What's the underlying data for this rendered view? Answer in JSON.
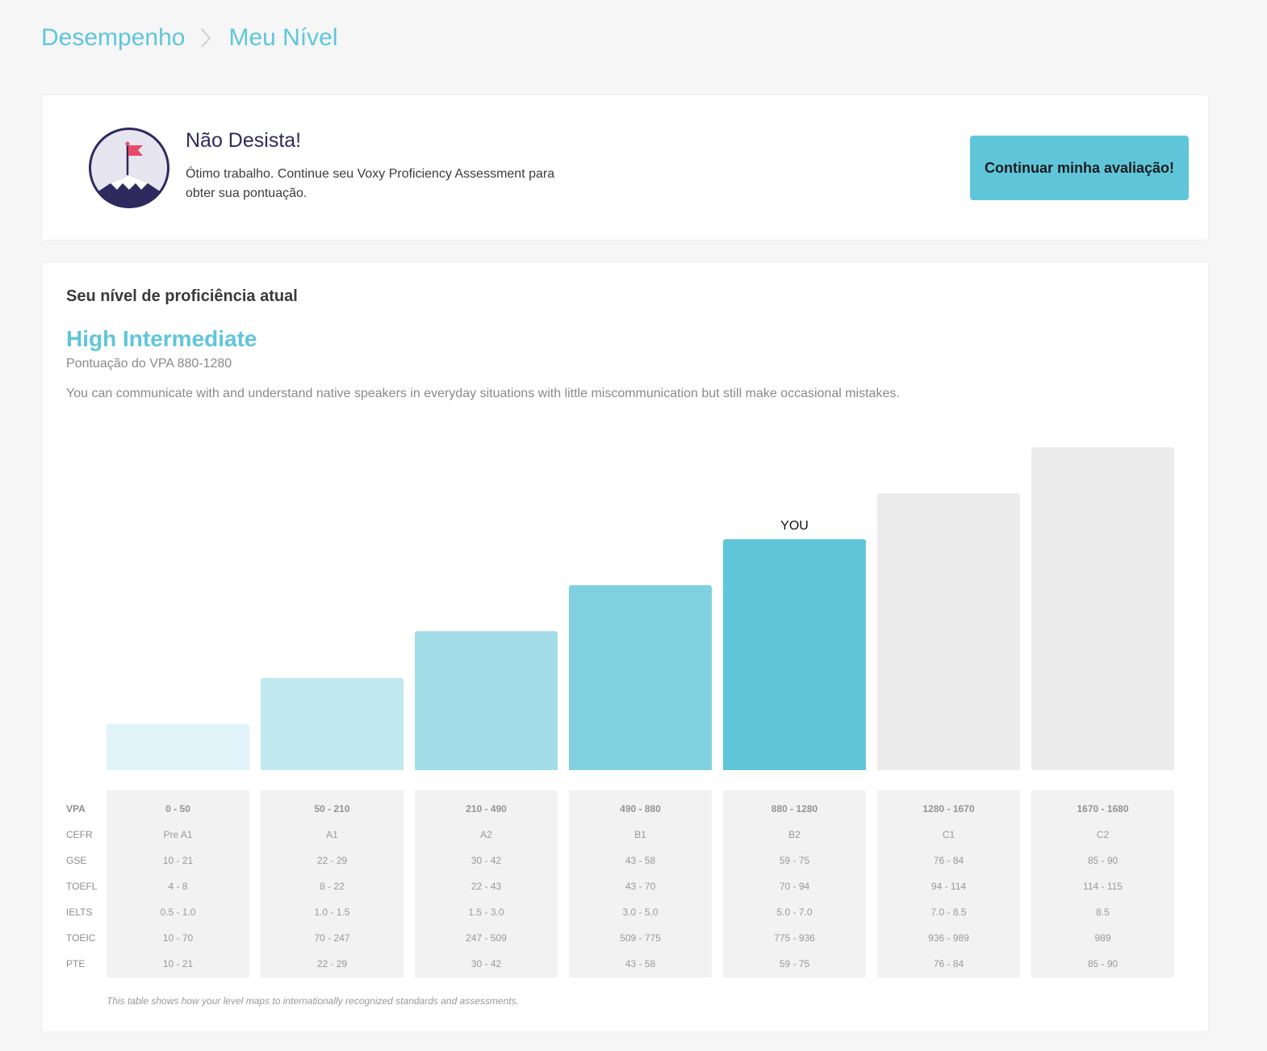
{
  "breadcrumb": {
    "parent": "Desempenho",
    "current": "Meu Nível"
  },
  "promo": {
    "title": "Não Desista!",
    "text": "Ótimo trabalho. Continue seu Voxy Proficiency Assessment para obter sua pontuação.",
    "button_label": "Continuar minha avaliação!",
    "badge_icon": "mountain-flag-icon"
  },
  "proficiency": {
    "section_title": "Seu nível de proficiência atual",
    "level_name": "High Intermediate",
    "score_text": "Pontuação do VPA 880-1280",
    "description": "You can communicate with and understand native speakers in everyday situations with little miscommunication but still make occasional mistakes."
  },
  "chart_data": {
    "type": "bar",
    "categories": [
      "0 - 50",
      "50 - 210",
      "210 - 490",
      "490 - 880",
      "880 - 1280",
      "1280 - 1670",
      "1670 - 1680"
    ],
    "values": [
      1,
      2,
      3,
      4,
      5,
      6,
      7
    ],
    "current_index": 4,
    "current_label": "YOU",
    "colors": [
      "#dff3f8",
      "#bfe8ef",
      "#a2dde8",
      "#80d1e0",
      "#5fc6da",
      "#ececec",
      "#ececec"
    ]
  },
  "mapping_table": {
    "row_labels": [
      "VPA",
      "CEFR",
      "GSE",
      "TOEFL",
      "IELTS",
      "TOEIC",
      "PTE"
    ],
    "columns": [
      [
        "0 - 50",
        "Pre A1",
        "10 - 21",
        "4 - 8",
        "0.5 - 1.0",
        "10 - 70",
        "10 - 21"
      ],
      [
        "50 - 210",
        "A1",
        "22 - 29",
        "8 - 22",
        "1.0 - 1.5",
        "70 - 247",
        "22 - 29"
      ],
      [
        "210 - 490",
        "A2",
        "30 - 42",
        "22 - 43",
        "1.5 - 3.0",
        "247 - 509",
        "30 - 42"
      ],
      [
        "490 - 880",
        "B1",
        "43 - 58",
        "43 - 70",
        "3.0 - 5.0",
        "509 - 775",
        "43 - 58"
      ],
      [
        "880 - 1280",
        "B2",
        "59 - 75",
        "70 - 94",
        "5.0 - 7.0",
        "775 - 936",
        "59 - 75"
      ],
      [
        "1280 - 1670",
        "C1",
        "76 - 84",
        "94 - 114",
        "7.0 - 8.5",
        "936 - 989",
        "76 - 84"
      ],
      [
        "1670 - 1680",
        "C2",
        "85 - 90",
        "114 - 115",
        "8.5",
        "989",
        "85 - 90"
      ]
    ],
    "footnote": "This table shows how your level maps to internationally recognized standards and assessments."
  }
}
